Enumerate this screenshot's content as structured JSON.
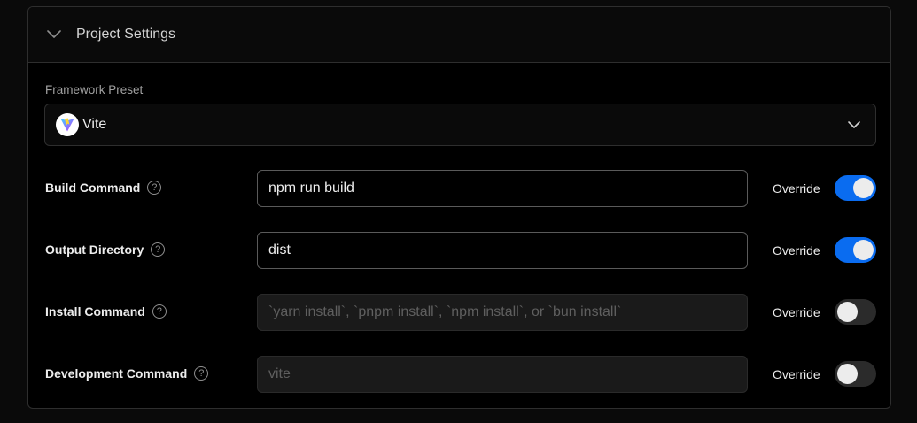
{
  "panel": {
    "title": "Project Settings",
    "expanded": true
  },
  "framework": {
    "label": "Framework Preset",
    "selected": "Vite",
    "icon": "vite-logo"
  },
  "settings": [
    {
      "label": "Build Command",
      "value": "npm run build",
      "placeholder": "",
      "override_label": "Override",
      "override": true
    },
    {
      "label": "Output Directory",
      "value": "dist",
      "placeholder": "",
      "override_label": "Override",
      "override": true
    },
    {
      "label": "Install Command",
      "value": "",
      "placeholder": "`yarn install`, `pnpm install`, `npm install`, or `bun install`",
      "override_label": "Override",
      "override": false
    },
    {
      "label": "Development Command",
      "value": "",
      "placeholder": "vite",
      "override_label": "Override",
      "override": false
    }
  ],
  "colors": {
    "toggle_on": "#0a6cf0",
    "toggle_off": "#2b2b2b",
    "border": "#2e2e2e"
  }
}
